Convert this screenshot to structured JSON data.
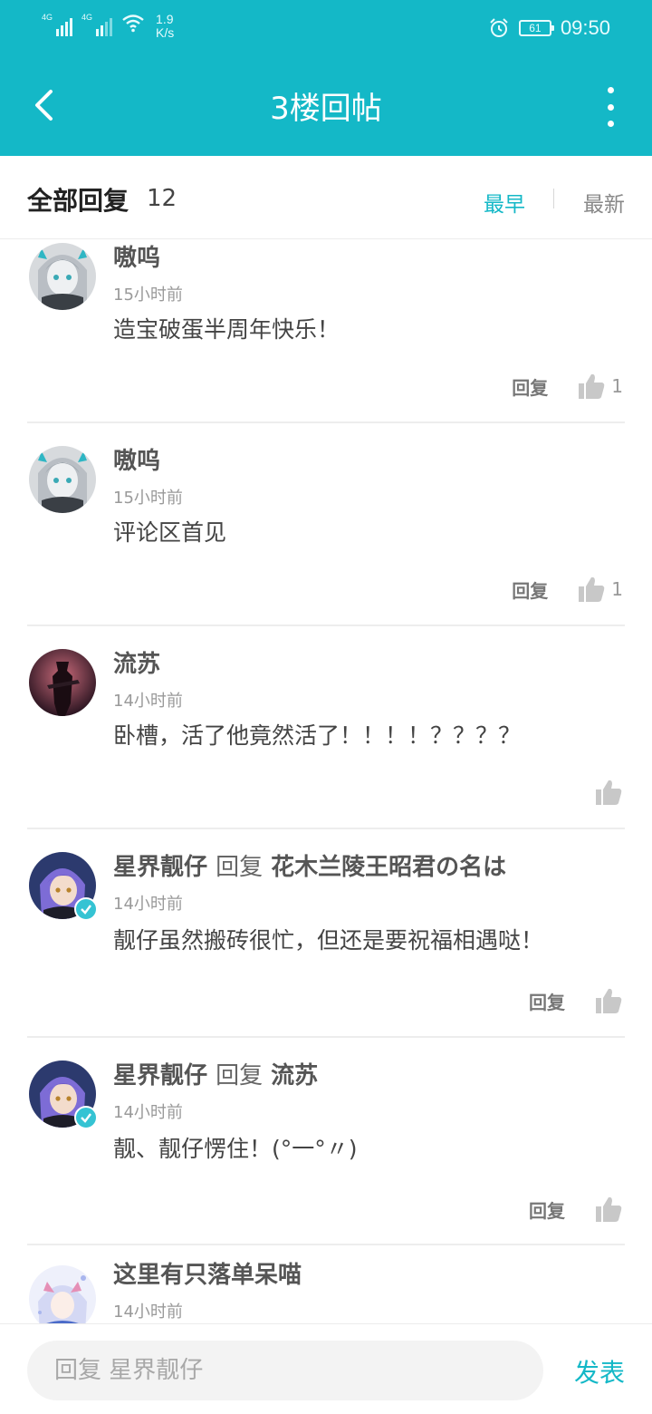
{
  "status_bar": {
    "signal1_label": "4G",
    "signal2_label": "4G",
    "speed_value": "1.9",
    "speed_unit": "K/s",
    "battery": "61",
    "time": "09:50"
  },
  "app_bar": {
    "title": "3楼回帖"
  },
  "sort": {
    "label": "全部回复",
    "count": "12",
    "option_earliest": "最早",
    "option_latest": "最新"
  },
  "comments": [
    {
      "name": "嗷呜",
      "time": "15小时前",
      "text": "造宝破蛋半周年快乐！",
      "reply_label": "回复",
      "likes": "1"
    },
    {
      "name": "嗷呜",
      "time": "15小时前",
      "text": "评论区首见",
      "reply_label": "回复",
      "likes": "1"
    },
    {
      "name": "流苏",
      "time": "14小时前",
      "text": "卧槽，活了他竟然活了！！！！？？？？"
    },
    {
      "name": "星界靓仔",
      "reply_word": "回复",
      "reply_target": "花木兰陵王昭君の名は",
      "time": "14小时前",
      "text": "靓仔虽然搬砖很忙，但还是要祝福相遇哒！",
      "reply_label": "回复"
    },
    {
      "name": "星界靓仔",
      "reply_word": "回复",
      "reply_target": "流苏",
      "time": "14小时前",
      "text": "靓、靓仔愣住！(°一°〃)",
      "reply_label": "回复"
    },
    {
      "name": "这里有只落单呆喵",
      "time": "14小时前"
    }
  ],
  "compose": {
    "placeholder": "回复 星界靓仔",
    "send_label": "发表"
  },
  "colors": {
    "accent": "#14b8c7",
    "verified_badge": "#35c3d3"
  }
}
